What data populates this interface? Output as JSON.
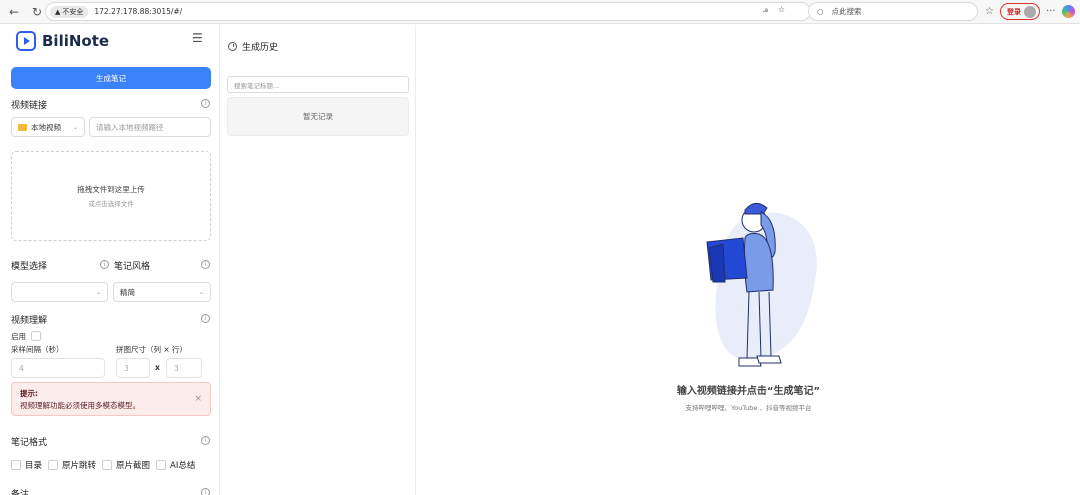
{
  "browser": {
    "insecure_label": "不安全",
    "url": "172.27.178.88:3015/#/",
    "search_placeholder": "点此搜索",
    "login_label": "登录"
  },
  "sidebar": {
    "logo_text": "BiliNote",
    "generate_button": "生成笔记",
    "video_link_label": "视频链接",
    "source_select": "本地视频",
    "path_placeholder": "请输入本地视频路径",
    "upload_main": "拖拽文件到这里上传",
    "upload_sub": "或点击选择文件",
    "model_label": "模型选择",
    "style_label": "笔记风格",
    "style_value": "精简",
    "video_understanding_label": "视频理解",
    "enable_label": "启用",
    "interval_label": "采样间隔（秒）",
    "interval_value": "4",
    "grid_label": "拼图尺寸（列 × 行）",
    "grid_cols": "3",
    "grid_x": "x",
    "grid_rows": "3",
    "tip_title": "提示:",
    "tip_body": "视频理解功能必须使用多模态模型。",
    "format_label": "笔记格式",
    "format_options": [
      "目录",
      "原片跳转",
      "原片截图",
      "AI总结"
    ],
    "remark_label": "备注"
  },
  "history": {
    "title": "生成历史",
    "search_placeholder": "搜索笔记标题...",
    "empty_text": "暂无记录"
  },
  "main": {
    "title": "输入视频链接并点击“生成笔记”",
    "subtitle": "支持哔哩哔哩、YouTube 、抖音等视频平台"
  },
  "colors": {
    "primary": "#3b82f6",
    "logo": "#2f5fe8",
    "tip_bg": "#fdecec"
  }
}
